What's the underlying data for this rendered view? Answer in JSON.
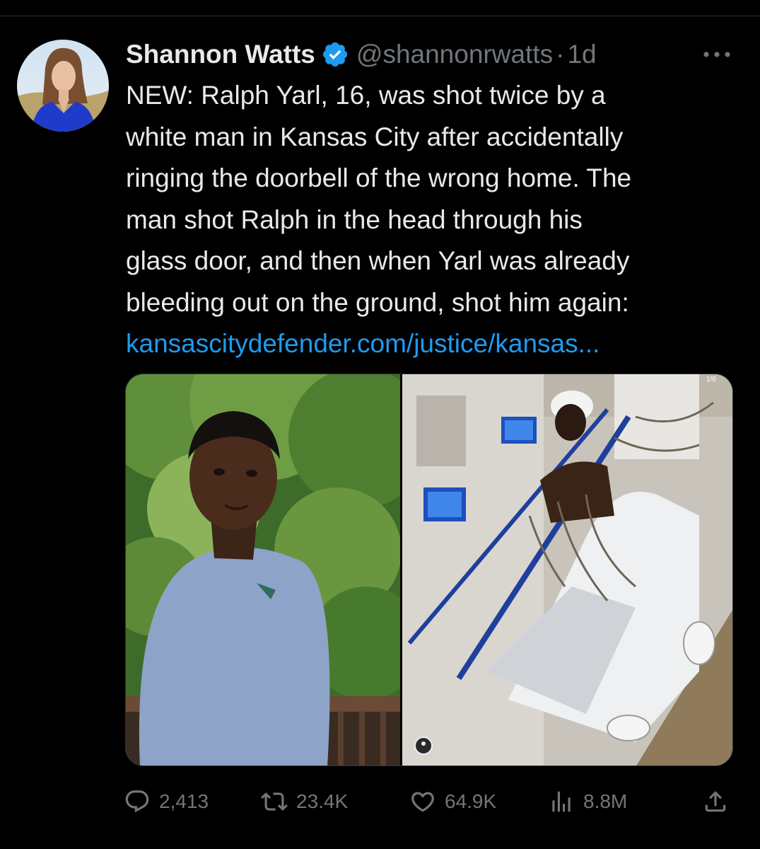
{
  "tweet": {
    "display_name": "Shannon Watts",
    "handle": "@shannonrwatts",
    "separator": "·",
    "time": "1d",
    "verified": true,
    "text_lines": [
      "NEW: Ralph Yarl, 16, was shot twice by a",
      "white man in Kansas City after accidentally",
      "ringing the doorbell of the wrong home. The",
      "man shot Ralph in the head through his",
      "glass door, and then when Yarl was already",
      "bleeding out on the ground, shot him again:"
    ],
    "link_text": "kansascitydefender.com/justice/kansas..."
  },
  "media": {
    "count": 2,
    "right_counter_text": "1/6"
  },
  "stats": {
    "replies": "2,413",
    "retweets": "23.4K",
    "likes": "64.9K",
    "views": "8.8M"
  },
  "colors": {
    "background": "#000000",
    "text_primary": "#e7e9ea",
    "text_secondary": "#71767b",
    "link": "#1d9bf0",
    "verified_badge": "#1d9bf0",
    "divider": "#2f3336"
  },
  "icons": {
    "verified": "verified-badge-icon",
    "more": "more-horizontal-icon",
    "reply": "reply-bubble-icon",
    "retweet": "retweet-icon",
    "like": "heart-icon",
    "views": "views-bar-chart-icon",
    "share": "share-upload-icon"
  }
}
